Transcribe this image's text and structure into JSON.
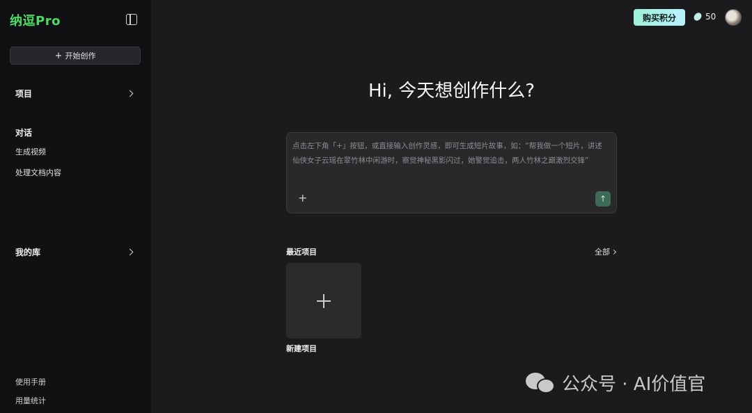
{
  "brand": {
    "name": "纳逗Pro",
    "color": "#4cd964"
  },
  "sidebar": {
    "start_button": "开始创作",
    "projects_label": "项目",
    "chat_section": "对话",
    "chat_items": [
      {
        "label": "生成视频"
      },
      {
        "label": "处理文档内容"
      }
    ],
    "library_label": "我的库",
    "footer_items": [
      {
        "label": "使用手册"
      },
      {
        "label": "用量统计"
      }
    ]
  },
  "topbar": {
    "buy_button": "购买积分",
    "credits": "50"
  },
  "main": {
    "greeting": "Hi, 今天想创作什么?",
    "prompt_placeholder": "点击左下角「+」按钮，或直接输入创作灵感，即可生成短片故事，如：“帮我做一个短片，讲述仙侠女子云瑶在翠竹林中闲游时，察觉神秘黑影闪过，她警觉追击，两人竹林之巅激烈交锋”",
    "recent_title": "最近项目",
    "view_all": "全部",
    "new_project_label": "新建项目"
  },
  "watermark": {
    "text": "公众号 · AI价值官"
  }
}
